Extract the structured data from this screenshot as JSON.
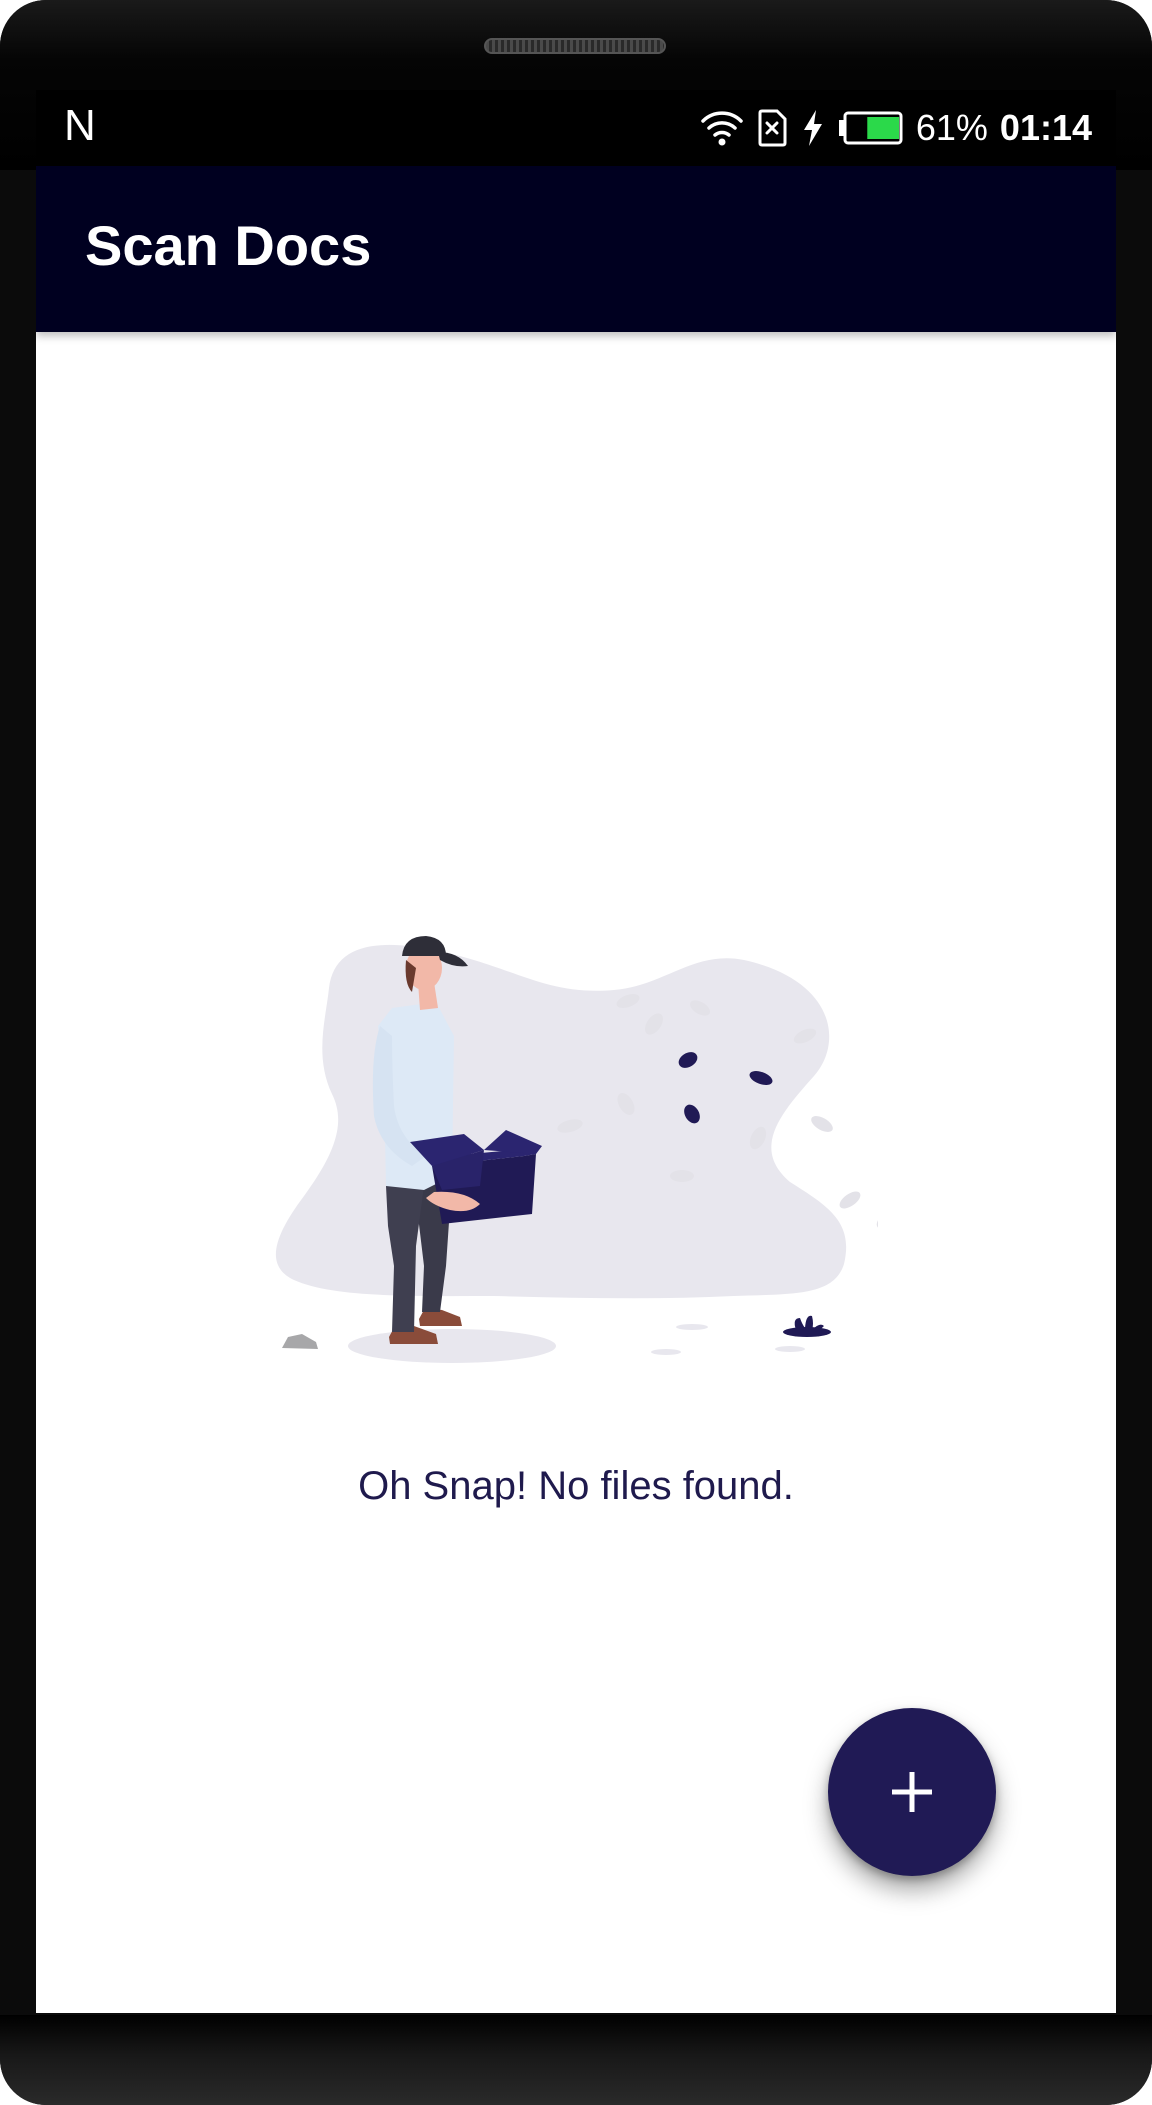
{
  "status_bar": {
    "carrier_glyph": "N",
    "battery_percent": "61%",
    "battery_level": 0.61,
    "time": "01:14",
    "icons": [
      "wifi-icon",
      "sim-no-card-icon",
      "charging-bolt-icon",
      "battery-icon"
    ],
    "battery_color": "#2bd94a"
  },
  "app_bar": {
    "title": "Scan Docs",
    "background": "#000020"
  },
  "empty_state": {
    "illustration": "person-holding-open-box",
    "message": "Oh Snap! No files found."
  },
  "fab": {
    "icon": "plus-icon",
    "color": "#201a55"
  }
}
